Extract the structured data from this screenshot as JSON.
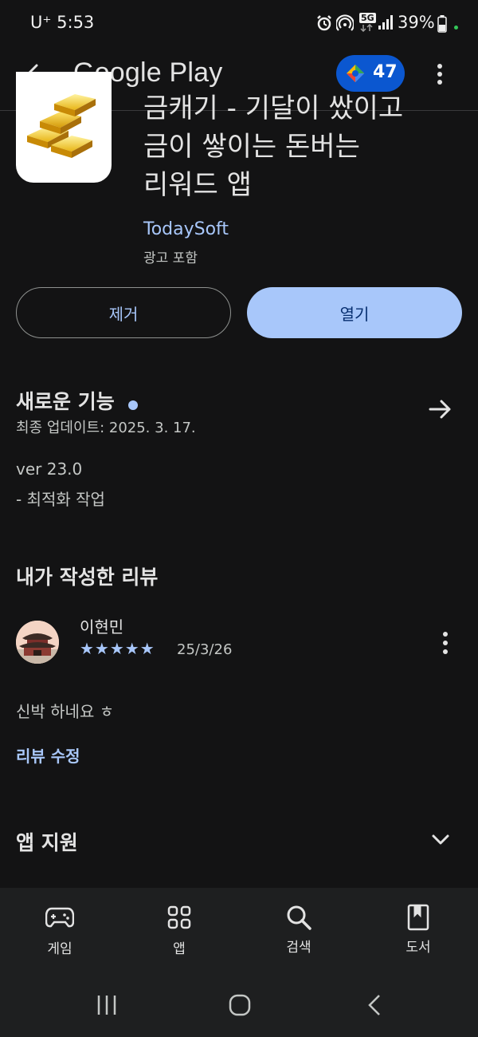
{
  "status_bar": {
    "carrier_time": "U⁺ 5:53",
    "network": "5G",
    "battery": "39%"
  },
  "appbar": {
    "title": "Google Play",
    "points": "47"
  },
  "app": {
    "title_line_1": "금캐기 - 기달이 쌌이고",
    "title_line_2": "금이 쌓이는 돈버는",
    "title_line_3": "리워드 앱",
    "developer": "TodaySoft",
    "ads_note": "광고 포함",
    "uninstall_label": "제거",
    "open_label": "열기"
  },
  "whats_new": {
    "title": "새로운 기능",
    "updated": "최종 업데이트: 2025. 3. 17.",
    "version": "ver 23.0",
    "note": "- 최적화 작업"
  },
  "my_review": {
    "section_title": "내가 작성한 리뷰",
    "reviewer": "이현민",
    "stars": 5,
    "date": "25/3/26",
    "text": "신박 하네요 ㅎ",
    "edit_label": "리뷰 수정"
  },
  "support": {
    "title": "앱 지원"
  },
  "bottom_nav": {
    "items": [
      {
        "label": "게임",
        "icon": "gamepad-icon"
      },
      {
        "label": "앱",
        "icon": "apps-grid-icon"
      },
      {
        "label": "검색",
        "icon": "search-icon"
      },
      {
        "label": "도서",
        "icon": "book-icon"
      }
    ]
  },
  "colors": {
    "background": "#131314",
    "accent": "#a8c7fa",
    "pill": "#0b57d0"
  }
}
